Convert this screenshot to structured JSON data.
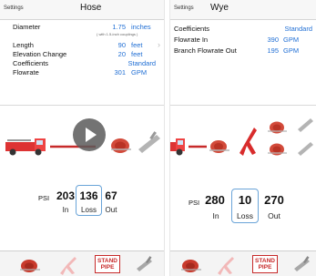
{
  "left": {
    "nav": {
      "settings_label": "Settings",
      "title": "Hose"
    },
    "settings": {
      "diameter": {
        "label": "Diameter",
        "value": "1.75",
        "unit": "inches",
        "note": "( with 1.5-inch couplings )"
      },
      "length": {
        "label": "Length",
        "value": "90",
        "unit": "feet"
      },
      "elevation": {
        "label": "Elevation Change",
        "value": "20",
        "unit": "feet"
      },
      "coefficients": {
        "label": "Coefficients",
        "value": "Standard"
      },
      "flowrate": {
        "label": "Flowrate",
        "value": "301",
        "unit": "GPM"
      }
    },
    "readout": {
      "psi_label": "PSI",
      "in_value": "203",
      "in_label": "In",
      "loss_value": "136",
      "loss_label": "Loss",
      "out_value": "67",
      "out_label": "Out"
    },
    "tabbar": {
      "standpipe_line1": "STAND",
      "standpipe_line2": "PIPE"
    }
  },
  "right": {
    "nav": {
      "settings_label": "Settings",
      "title": "Wye"
    },
    "settings": {
      "coefficients": {
        "label": "Coefficients",
        "value": "Standard"
      },
      "flowrate_in": {
        "label": "Flowrate In",
        "value": "390",
        "unit": "GPM"
      },
      "branch_flowrate_out": {
        "label": "Branch Flowrate Out",
        "value": "195",
        "unit": "GPM"
      }
    },
    "readout": {
      "psi_label": "PSI",
      "in_value": "280",
      "in_label": "In",
      "loss_value": "10",
      "loss_label": "Loss",
      "out_value": "270",
      "out_label": "Out"
    },
    "tabbar": {
      "standpipe_line1": "STAND",
      "standpipe_line2": "PIPE"
    }
  },
  "colors": {
    "accent": "#1f6ed4",
    "hose_red": "#c72a2a",
    "loss_border": "#6aa4d8"
  },
  "icons": [
    "fire-engine-icon",
    "hose-reel-icon",
    "wye-icon",
    "nozzle-icon",
    "play-icon",
    "chevron-right-icon"
  ]
}
